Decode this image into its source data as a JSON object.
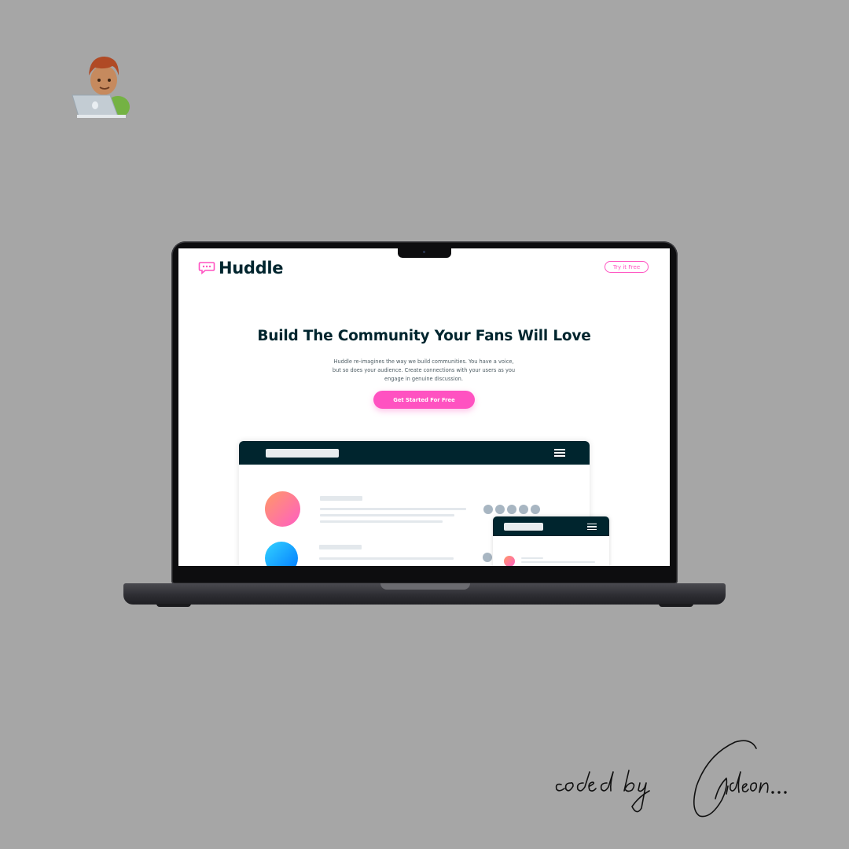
{
  "decoration": {
    "developer_icon": "technologist-emoji"
  },
  "huddle": {
    "logo_text": "Huddle",
    "logo_icon": "chat-bubble-icon",
    "nav_button": "Try it Free",
    "hero_title": "Build The Community Your Fans Will Love",
    "hero_description": "Huddle re-imagines the way we build communities. You have a voice, but so does your audience. Create connections with your users as you engage in genuine discussion.",
    "cta_button": "Get Started For Free",
    "colors": {
      "accent_pink": "#ff52c1",
      "dark_teal": "#00252e",
      "background": "#ffffff"
    }
  },
  "signature": {
    "text": "coded by Gideon..."
  }
}
